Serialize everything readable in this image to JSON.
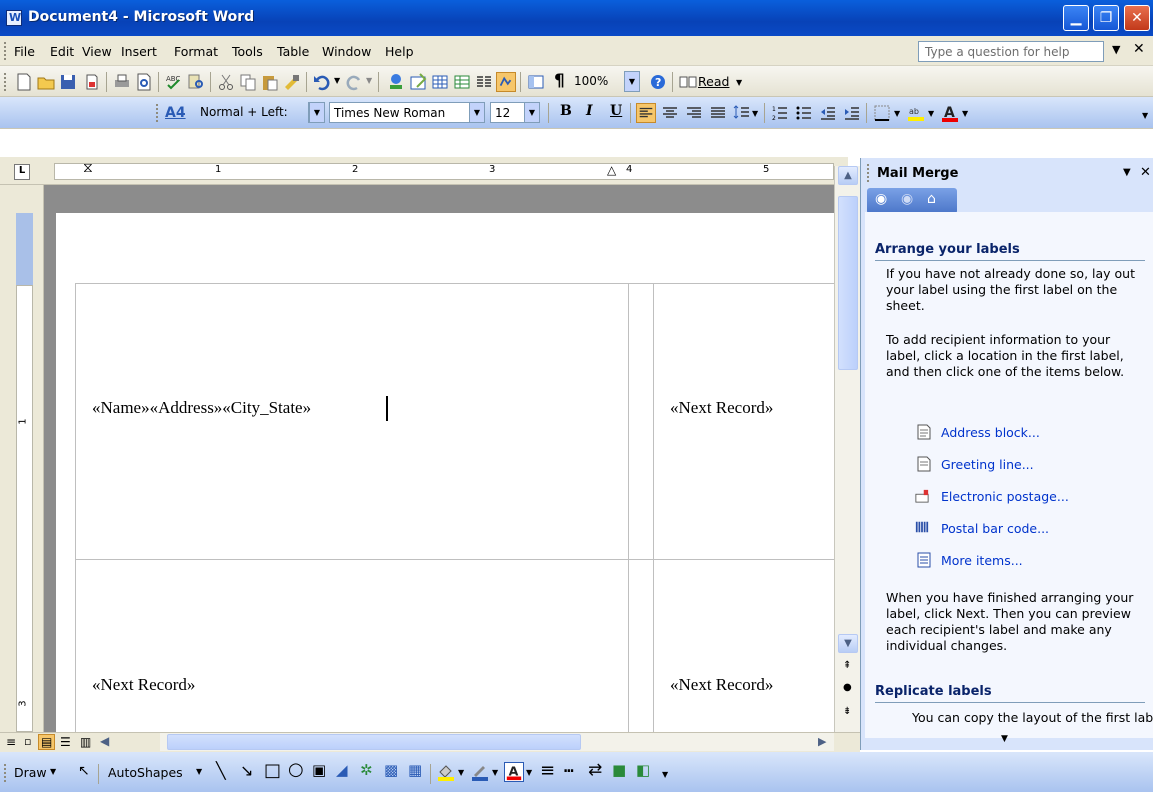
{
  "window": {
    "title": "Document4 - Microsoft Word"
  },
  "menu": {
    "items": [
      "File",
      "Edit",
      "View",
      "Insert",
      "Format",
      "Tools",
      "Table",
      "Window",
      "Help"
    ],
    "help_placeholder": "Type a question for help"
  },
  "standard_toolbar": {
    "zoom": "100%",
    "read_label": "Read"
  },
  "formatting_toolbar": {
    "style": "Normal + Left:",
    "font": "Times New Roman",
    "size": "12",
    "bold": "B",
    "italic": "I",
    "underline": "U"
  },
  "ruler": {
    "numbers": [
      "1",
      "2",
      "3",
      "4",
      "5"
    ],
    "vnumbers": [
      "1",
      "3"
    ]
  },
  "document": {
    "cell1": "«Name»«Address»«City_State»",
    "cell2": "«Next Record»",
    "cell3": "«Next Record»",
    "cell4": "«Next Record»"
  },
  "task_pane": {
    "title": "Mail Merge",
    "section1": "Arrange your labels",
    "para1": "If you have not already done so, lay out your label using the first label on the sheet.",
    "para2": "To add recipient information to your label, click a location in the first label, and then click one of the items below.",
    "links": [
      "Address block...",
      "Greeting line...",
      "Electronic postage...",
      "Postal bar code...",
      "More items..."
    ],
    "para3": "When you have finished arranging your label, click Next. Then you can preview each recipient's label and make any individual changes.",
    "section2": "Replicate labels",
    "para4": "You can copy the layout of the first label to the other labels on the"
  },
  "draw_toolbar": {
    "draw": "Draw",
    "autoshapes": "AutoShapes"
  }
}
